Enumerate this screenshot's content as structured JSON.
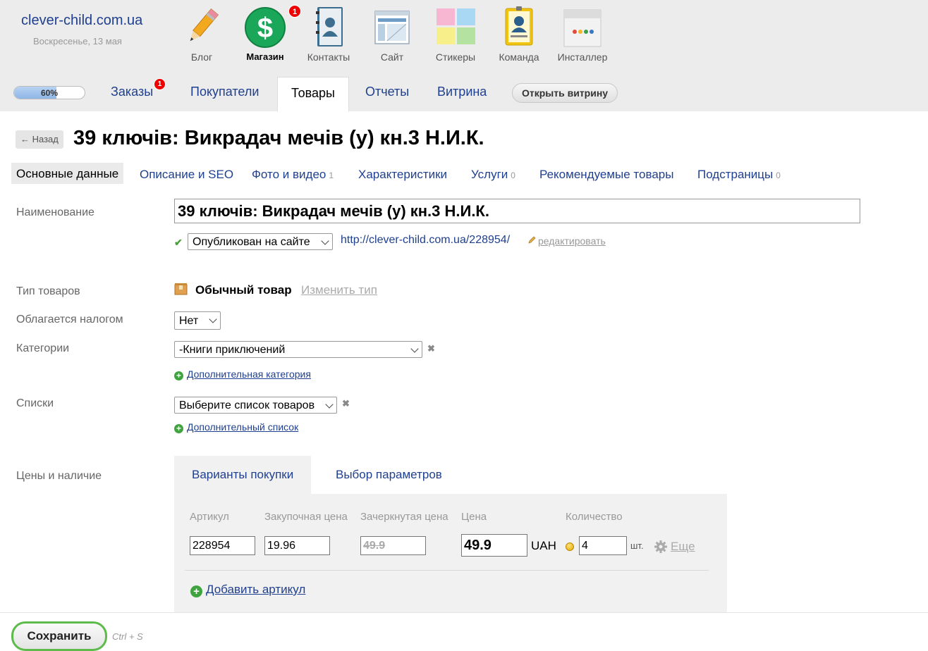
{
  "header": {
    "site_name": "clever-child.com.ua",
    "date": "Воскресенье, 13 мая",
    "apps": [
      {
        "label": "Блог"
      },
      {
        "label": "Магазин",
        "badge": "1"
      },
      {
        "label": "Контакты"
      },
      {
        "label": "Сайт"
      },
      {
        "label": "Стикеры"
      },
      {
        "label": "Команда"
      },
      {
        "label": "Инсталлер"
      }
    ]
  },
  "nav": {
    "progress_label": "60%",
    "progress_value": 0.6,
    "tabs": [
      {
        "label": "Заказы",
        "badge": "1"
      },
      {
        "label": "Покупатели"
      },
      {
        "label": "Товары"
      },
      {
        "label": "Отчеты"
      },
      {
        "label": "Витрина"
      }
    ],
    "open_store": "Открыть витрину"
  },
  "page": {
    "back": "← Назад",
    "title": "39 ключів: Викрадач мечів (у) кн.3 Н.И.К."
  },
  "subtabs": [
    {
      "label": "Основные данные"
    },
    {
      "label": "Описание и SEO"
    },
    {
      "label": "Фото и видео",
      "count": "1"
    },
    {
      "label": "Характеристики"
    },
    {
      "label": "Услуги",
      "count": "0"
    },
    {
      "label": "Рекомендуемые товары"
    },
    {
      "label": "Подстраницы",
      "count": "0"
    }
  ],
  "form": {
    "name_label": "Наименование",
    "name_value": "39 ключів: Викрадач мечів (у) кн.3 Н.И.К.",
    "status_value": "Опубликован на сайте",
    "url": "http://clever-child.com.ua/228954/",
    "edit_url": "редактировать",
    "type_label": "Тип товаров",
    "type_value": "Обычный товар",
    "change_type": "Изменить тип",
    "tax_label": "Облагается налогом",
    "tax_value": "Нет",
    "category_label": "Категории",
    "category_value": "-Книги приключений",
    "add_category": "Дополнительная категория",
    "lists_label": "Списки",
    "lists_value": "Выберите список товаров",
    "add_list": "Дополнительный список",
    "prices_label": "Цены и наличие"
  },
  "prices": {
    "tabs": [
      {
        "label": "Варианты покупки"
      },
      {
        "label": "Выбор параметров"
      }
    ],
    "columns": {
      "sku": "Артикул",
      "purchase": "Закупочная цена",
      "compare": "Зачеркнутая цена",
      "price": "Цена",
      "quantity": "Количество"
    },
    "row": {
      "sku": "228954",
      "purchase": "19.96",
      "compare": "49.9",
      "price": "49.9",
      "currency": "UAH",
      "quantity": "4",
      "unit": "шт.",
      "more": "Еще"
    },
    "add_sku": "Добавить артикул"
  },
  "footer": {
    "save": "Сохранить",
    "hint": "Ctrl + S"
  },
  "colors": {
    "link": "#1f3f8f",
    "save_border": "#5dbb4b",
    "badge": "#ee0000"
  }
}
